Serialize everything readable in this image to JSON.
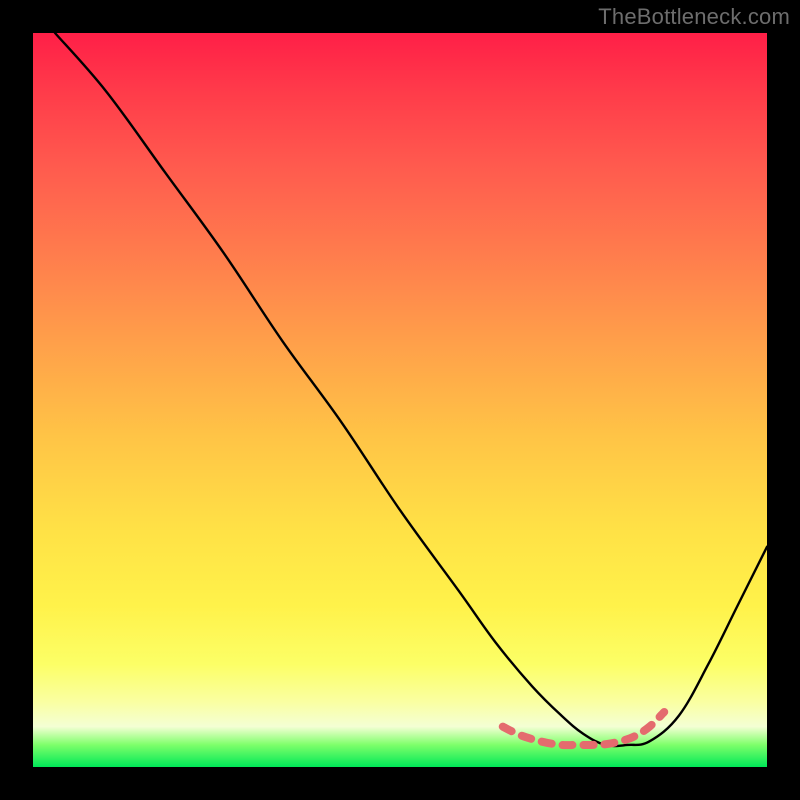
{
  "watermark": "TheBottleneck.com",
  "chart_data": {
    "type": "line",
    "title": "",
    "xlabel": "",
    "ylabel": "",
    "xlim": [
      0,
      100
    ],
    "ylim": [
      0,
      100
    ],
    "series": [
      {
        "name": "black-curve",
        "color": "#000000",
        "x": [
          3,
          10,
          18,
          26,
          34,
          42,
          50,
          58,
          63,
          68,
          72,
          75,
          78,
          81,
          84,
          88,
          92,
          96,
          100
        ],
        "y": [
          100,
          92,
          81,
          70,
          58,
          47,
          35,
          24,
          17,
          11,
          7,
          4.5,
          3,
          3,
          3.5,
          7,
          14,
          22,
          30
        ]
      },
      {
        "name": "bottom-accent",
        "color": "#e46b6e",
        "x": [
          64,
          66,
          68,
          70,
          72,
          74,
          76,
          78,
          80,
          82,
          84,
          86
        ],
        "y": [
          5.5,
          4.5,
          3.8,
          3.3,
          3.0,
          3.0,
          3.0,
          3.1,
          3.5,
          4.2,
          5.5,
          7.5
        ]
      }
    ]
  }
}
